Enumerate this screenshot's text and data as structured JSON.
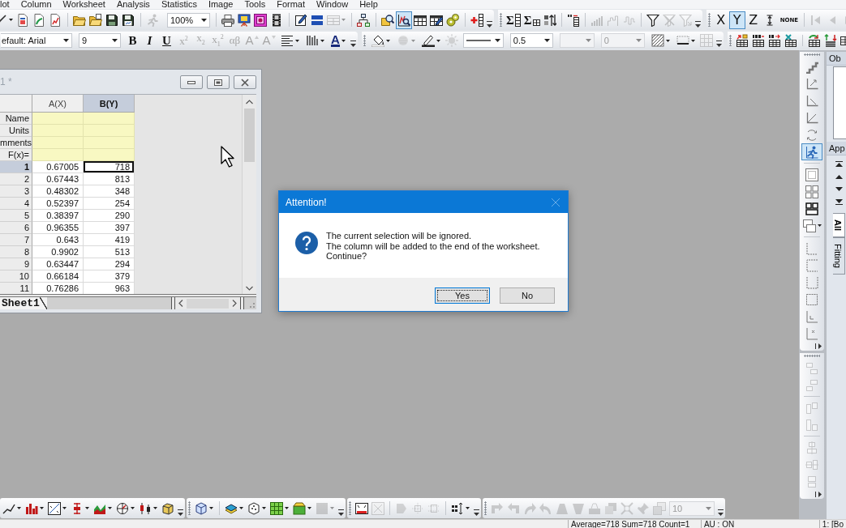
{
  "menu_bar": [
    "lot",
    "Column",
    "Worksheet",
    "Analysis",
    "Statistics",
    "Image",
    "Tools",
    "Format",
    "Window",
    "Help"
  ],
  "toolbar_row_1": [
    [
      {
        "kind": "button",
        "disabled": false,
        "pressed": false
      },
      {
        "kind": "button",
        "disabled": false,
        "pressed": false
      },
      {
        "kind": "button",
        "disabled": false,
        "pressed": false
      },
      {
        "kind": "button",
        "disabled": false,
        "pressed": false
      },
      {
        "kind": "button",
        "disabled": false,
        "pressed": false
      },
      {
        "kind": "button",
        "disabled": false,
        "pressed": false
      },
      {
        "kind": "button",
        "disabled": false,
        "pressed": false
      },
      {
        "kind": "button",
        "disabled": false,
        "pressed": false
      },
      {
        "kind": "button",
        "disabled": true,
        "pressed": false
      },
      {
        "kind": "combo",
        "value": "100%",
        "disabled": false
      },
      {
        "kind": "button",
        "disabled": false,
        "pressed": false
      },
      {
        "kind": "button",
        "disabled": false,
        "pressed": false
      },
      {
        "kind": "button",
        "disabled": false,
        "pressed": false
      },
      {
        "kind": "button",
        "disabled": false,
        "pressed": false
      },
      {
        "kind": "button",
        "disabled": false,
        "pressed": false
      },
      {
        "kind": "button",
        "disabled": false,
        "pressed": false
      },
      {
        "kind": "button",
        "disabled": true,
        "pressed": false
      },
      {
        "kind": "button",
        "disabled": false,
        "pressed": false
      },
      {
        "kind": "button",
        "disabled": false,
        "pressed": false
      },
      {
        "kind": "button",
        "disabled": false,
        "pressed": true
      },
      {
        "kind": "button",
        "disabled": false,
        "pressed": false
      },
      {
        "kind": "button",
        "disabled": false,
        "pressed": false
      },
      {
        "kind": "button",
        "disabled": false,
        "pressed": false
      },
      {
        "kind": "button",
        "disabled": false,
        "pressed": false
      }
    ],
    [
      {
        "kind": "text",
        "label": "Σ",
        "disabled": false
      },
      {
        "kind": "text",
        "label": "Σ",
        "disabled": false
      },
      {
        "kind": "button",
        "disabled": false
      },
      {
        "kind": "button",
        "disabled": false
      },
      {
        "kind": "button",
        "disabled": true
      },
      {
        "kind": "button",
        "disabled": true
      },
      {
        "kind": "button",
        "disabled": true
      },
      {
        "kind": "button",
        "disabled": false
      },
      {
        "kind": "button",
        "disabled": true
      },
      {
        "kind": "button",
        "disabled": true
      }
    ],
    [
      {
        "kind": "text",
        "label": "X",
        "disabled": false,
        "pressed": false
      },
      {
        "kind": "text",
        "label": "Y",
        "disabled": false,
        "pressed": true
      },
      {
        "kind": "text",
        "label": "Z",
        "disabled": false,
        "pressed": false
      },
      {
        "kind": "button",
        "disabled": false,
        "pressed": false
      },
      {
        "kind": "text",
        "label": "NONE",
        "disabled": false,
        "pressed": false
      },
      {
        "kind": "button",
        "disabled": true,
        "pressed": false
      },
      {
        "kind": "button",
        "disabled": true,
        "pressed": false
      },
      {
        "kind": "button",
        "disabled": true,
        "pressed": false
      }
    ]
  ],
  "toolbar_row_2": [
    [
      {
        "kind": "combo",
        "value": "efault: Arial",
        "disabled": false
      },
      {
        "kind": "combo",
        "value": "9",
        "disabled": false
      },
      {
        "kind": "text",
        "label": "B",
        "disabled": false
      },
      {
        "kind": "text",
        "label": "I",
        "disabled": false
      },
      {
        "kind": "text",
        "label": "U",
        "disabled": false
      },
      {
        "kind": "text",
        "label": "x$^{2}$",
        "disabled": true
      },
      {
        "kind": "text",
        "label": "x$_{2}$",
        "disabled": true
      },
      {
        "kind": "text",
        "label": "x$_{1}$$^{2}$",
        "disabled": true
      },
      {
        "kind": "text",
        "label": "αβ",
        "disabled": true
      },
      {
        "kind": "text",
        "label": "A",
        "disabled": true
      },
      {
        "kind": "text",
        "label": "A",
        "disabled": true
      },
      {
        "kind": "button",
        "disabled": false
      },
      {
        "kind": "button",
        "disabled": false
      },
      {
        "kind": "text",
        "label": "A",
        "disabled": false
      }
    ],
    [
      {
        "kind": "button",
        "disabled": false
      },
      {
        "kind": "button",
        "disabled": true
      },
      {
        "kind": "button",
        "disabled": false
      },
      {
        "kind": "button",
        "disabled": true
      },
      {
        "kind": "line_combo",
        "disabled": false
      },
      {
        "kind": "combo",
        "value": "0.5",
        "disabled": false
      },
      {
        "kind": "combo",
        "disabled": true
      },
      {
        "kind": "combo",
        "value": "0",
        "disabled": true
      },
      {
        "kind": "button",
        "disabled": false
      },
      {
        "kind": "button",
        "disabled": false
      },
      {
        "kind": "button",
        "disabled": true
      }
    ],
    [
      {
        "kind": "button",
        "disabled": false
      },
      {
        "kind": "button",
        "disabled": false
      },
      {
        "kind": "button",
        "disabled": false
      },
      {
        "kind": "button",
        "disabled": false
      },
      {
        "kind": "button",
        "disabled": false
      },
      {
        "kind": "button",
        "disabled": false
      },
      {
        "kind": "button",
        "disabled": false
      }
    ]
  ],
  "worksheet": {
    "title": "1 *",
    "columns": [
      {
        "label": "A(X)",
        "selected": false
      },
      {
        "label": "B(Y)",
        "selected": true
      }
    ],
    "label_rows": [
      "Name",
      "Units",
      "mments",
      "F(x)="
    ],
    "rows": [
      {
        "header": "1",
        "selected": true,
        "cells": [
          {
            "value": "0.67005",
            "active": false
          },
          {
            "value": "718",
            "active": true
          }
        ]
      },
      {
        "header": "2",
        "selected": false,
        "cells": [
          {
            "value": "0.67443",
            "active": false
          },
          {
            "value": "813",
            "active": false
          }
        ]
      },
      {
        "header": "3",
        "selected": false,
        "cells": [
          {
            "value": "0.48302",
            "active": false
          },
          {
            "value": "348",
            "active": false
          }
        ]
      },
      {
        "header": "4",
        "selected": false,
        "cells": [
          {
            "value": "0.52397",
            "active": false
          },
          {
            "value": "254",
            "active": false
          }
        ]
      },
      {
        "header": "5",
        "selected": false,
        "cells": [
          {
            "value": "0.38397",
            "active": false
          },
          {
            "value": "290",
            "active": false
          }
        ]
      },
      {
        "header": "6",
        "selected": false,
        "cells": [
          {
            "value": "0.96355",
            "active": false
          },
          {
            "value": "397",
            "active": false
          }
        ]
      },
      {
        "header": "7",
        "selected": false,
        "cells": [
          {
            "value": "0.643",
            "active": false
          },
          {
            "value": "419",
            "active": false
          }
        ]
      },
      {
        "header": "8",
        "selected": false,
        "cells": [
          {
            "value": "0.9902",
            "active": false
          },
          {
            "value": "513",
            "active": false
          }
        ]
      },
      {
        "header": "9",
        "selected": false,
        "cells": [
          {
            "value": "0.63447",
            "active": false
          },
          {
            "value": "294",
            "active": false
          }
        ]
      },
      {
        "header": "10",
        "selected": false,
        "cells": [
          {
            "value": "0.66184",
            "active": false
          },
          {
            "value": "379",
            "active": false
          }
        ]
      },
      {
        "header": "11",
        "selected": false,
        "cells": [
          {
            "value": "0.76286",
            "active": false
          },
          {
            "value": "963",
            "active": false
          }
        ]
      }
    ],
    "sheet_tabs": [
      {
        "label": "Sheet1",
        "selected": true
      }
    ]
  },
  "dialog": {
    "title": "Attention!",
    "message": "The current selection will be ignored.\nThe column will be added to the end of the worksheet.\nContinue?",
    "buttons": [
      {
        "label": "Yes",
        "focused": true
      },
      {
        "label": "No",
        "focused": false
      }
    ]
  },
  "side_toolbars": [
    [
      {
        "kind": "button",
        "disabled": false,
        "pressed": false
      },
      {
        "kind": "button",
        "disabled": false,
        "pressed": false
      },
      {
        "kind": "button",
        "disabled": false,
        "pressed": false
      },
      {
        "kind": "button",
        "disabled": false,
        "pressed": false
      },
      {
        "kind": "button",
        "disabled": false,
        "pressed": false
      },
      {
        "kind": "button",
        "disabled": false,
        "pressed": true
      },
      {
        "kind": "button",
        "disabled": false,
        "pressed": false
      },
      {
        "kind": "button",
        "disabled": false,
        "pressed": false
      },
      {
        "kind": "button",
        "disabled": false,
        "pressed": false
      },
      {
        "kind": "button",
        "disabled": false,
        "pressed": false
      },
      {
        "kind": "button",
        "disabled": false,
        "pressed": false
      },
      {
        "kind": "button",
        "disabled": false,
        "pressed": false
      },
      {
        "kind": "button",
        "disabled": false,
        "pressed": false
      },
      {
        "kind": "button",
        "disabled": false,
        "pressed": false
      },
      {
        "kind": "button",
        "disabled": false,
        "pressed": false
      },
      {
        "kind": "button",
        "disabled": false,
        "pressed": false
      }
    ],
    [
      {
        "kind": "button",
        "disabled": true
      },
      {
        "kind": "button",
        "disabled": true
      },
      {
        "kind": "button",
        "disabled": true
      },
      {
        "kind": "button",
        "disabled": true
      },
      {
        "kind": "button",
        "disabled": true
      },
      {
        "kind": "button",
        "disabled": true
      },
      {
        "kind": "button",
        "disabled": true
      }
    ]
  ],
  "side_panels": [
    {
      "title": "Ob"
    },
    {
      "title": "App",
      "tabs": [
        {
          "label": "All",
          "selected": true
        },
        {
          "label": "Fitting",
          "selected": false
        }
      ]
    }
  ],
  "bottom_toolbars": [
    [
      {
        "kind": "button",
        "disabled": false
      },
      {
        "kind": "button",
        "disabled": false
      },
      {
        "kind": "button",
        "disabled": false
      },
      {
        "kind": "button",
        "disabled": false
      },
      {
        "kind": "button",
        "disabled": false
      },
      {
        "kind": "button",
        "disabled": false
      },
      {
        "kind": "button",
        "disabled": false
      },
      {
        "kind": "button",
        "disabled": false
      }
    ],
    [
      {
        "kind": "button",
        "disabled": false
      },
      {
        "kind": "button",
        "disabled": false
      },
      {
        "kind": "button",
        "disabled": false
      },
      {
        "kind": "button",
        "disabled": false
      },
      {
        "kind": "button",
        "disabled": false
      },
      {
        "kind": "button",
        "disabled": true
      }
    ],
    [
      {
        "kind": "button",
        "disabled": false
      },
      {
        "kind": "button",
        "disabled": true
      },
      {
        "kind": "button",
        "disabled": true
      },
      {
        "kind": "button",
        "disabled": true
      },
      {
        "kind": "button",
        "disabled": true
      },
      {
        "kind": "button",
        "disabled": false
      }
    ],
    [
      {
        "kind": "button",
        "disabled": true
      },
      {
        "kind": "button",
        "disabled": true
      },
      {
        "kind": "button",
        "disabled": true
      },
      {
        "kind": "button",
        "disabled": true
      },
      {
        "kind": "button",
        "disabled": true
      },
      {
        "kind": "button",
        "disabled": true
      },
      {
        "kind": "button",
        "disabled": true
      },
      {
        "kind": "button",
        "disabled": true
      },
      {
        "kind": "button",
        "disabled": true
      },
      {
        "kind": "button",
        "disabled": true
      },
      {
        "kind": "button",
        "disabled": true
      },
      {
        "kind": "combo",
        "value": "10",
        "disabled": true
      }
    ]
  ],
  "status_bar": [
    "Average=718 Sum=718 Count=1",
    "AU : ON",
    "1: [Bo"
  ]
}
